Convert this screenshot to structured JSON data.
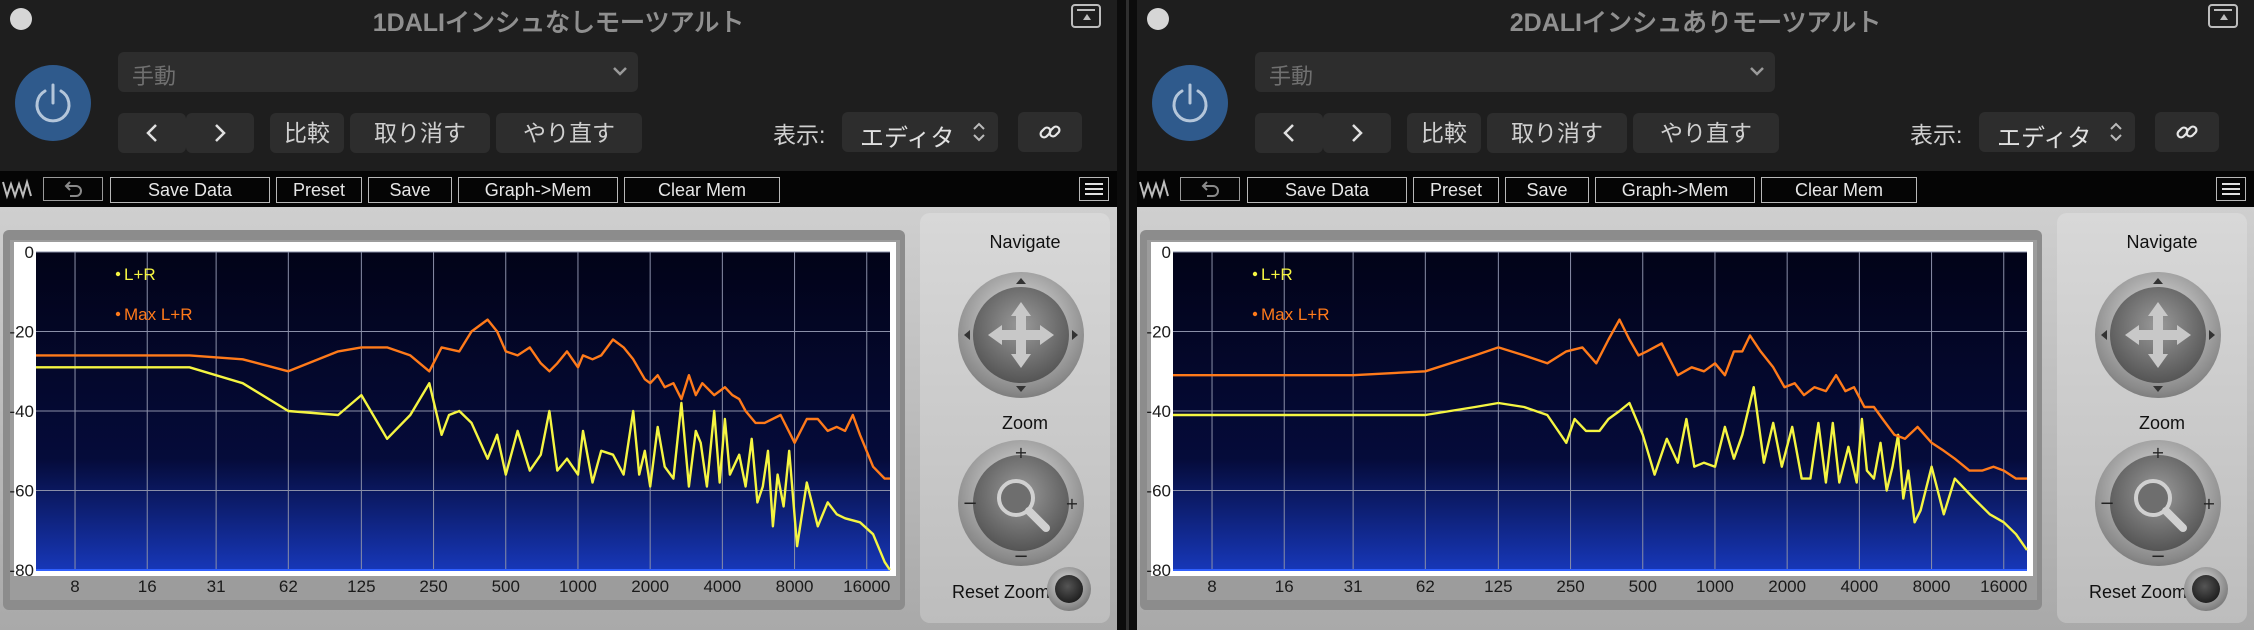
{
  "windows": [
    {
      "title": "1DALIインシュなしモーツアルト",
      "preset_value": "手動",
      "compare_label": "比較",
      "undo_label": "取り消す",
      "redo_label": "やり直す",
      "display_label": "表示:",
      "display_value": "エディタ",
      "toolbar": {
        "save_data": "Save Data",
        "preset": "Preset",
        "save": "Save",
        "graph_mem": "Graph->Mem",
        "clear_mem": "Clear Mem"
      },
      "navigate_label": "Navigate",
      "zoom_label": "Zoom",
      "reset_zoom_label": "Reset Zoom",
      "chart_data": {
        "type": "line",
        "x_scale": "log",
        "x_ticks": [
          8,
          16,
          31,
          62,
          125,
          250,
          500,
          1000,
          2000,
          4000,
          8000,
          16000
        ],
        "x_tick_labels": [
          "8",
          "16",
          "31",
          "62",
          "125",
          "250",
          "500",
          "1000",
          "2000",
          "4000",
          "8000",
          "16000"
        ],
        "y_ticks": [
          0,
          -20,
          -40,
          -60,
          -80
        ],
        "y_tick_labels": [
          "0",
          "-20",
          "-40",
          "-60",
          "-80"
        ],
        "ylim": [
          -80,
          0
        ],
        "xlim": [
          5.5,
          20000
        ],
        "grid": true,
        "legend": "top-left",
        "series": [
          {
            "name": "L+R",
            "color": "#f5f542",
            "x": [
              5.5,
              8,
              16,
              24,
              40,
              62,
              100,
              125,
              160,
              200,
              240,
              270,
              290,
              320,
              360,
              420,
              460,
              500,
              560,
              630,
              700,
              760,
              820,
              900,
              1000,
              1050,
              1150,
              1250,
              1400,
              1550,
              1700,
              1800,
              1900,
              2000,
              2150,
              2300,
              2500,
              2700,
              2900,
              3100,
              3250,
              3450,
              3700,
              3900,
              4100,
              4300,
              4700,
              5000,
              5300,
              5600,
              5900,
              6200,
              6500,
              6800,
              7200,
              7600,
              8200,
              9000,
              10000,
              11000,
              12000,
              13000,
              15000,
              17000,
              19000,
              20000
            ],
            "y": [
              -29,
              -29,
              -29,
              -29,
              -33,
              -40,
              -41,
              -36,
              -47,
              -41,
              -33,
              -46,
              -41,
              -40,
              -43,
              -52,
              -46,
              -56,
              -45,
              -55,
              -51,
              -40,
              -55,
              -52,
              -56,
              -45,
              -58,
              -50,
              -51,
              -56,
              -40,
              -56,
              -50,
              -59,
              -44,
              -54,
              -57,
              -38,
              -59,
              -45,
              -48,
              -59,
              -40,
              -58,
              -42,
              -56,
              -51,
              -59,
              -47,
              -63,
              -59,
              -50,
              -69,
              -56,
              -64,
              -50,
              -74,
              -58,
              -69,
              -63,
              -66,
              -67,
              -68,
              -71,
              -78,
              -80
            ]
          },
          {
            "name": "Max L+R",
            "color": "#ff7a1a",
            "x": [
              5.5,
              8,
              16,
              24,
              40,
              62,
              100,
              125,
              160,
              200,
              240,
              270,
              320,
              360,
              420,
              460,
              500,
              560,
              630,
              700,
              760,
              820,
              900,
              1000,
              1050,
              1150,
              1250,
              1400,
              1550,
              1700,
              1900,
              2000,
              2150,
              2300,
              2500,
              2700,
              2900,
              3100,
              3300,
              3700,
              4100,
              4400,
              4700,
              5000,
              5500,
              6000,
              7000,
              8000,
              9000,
              10000,
              11000,
              12000,
              13000,
              14000,
              15000,
              17000,
              19000,
              20000
            ],
            "y": [
              -26,
              -26,
              -26,
              -26,
              -27,
              -30,
              -25,
              -24,
              -24,
              -26,
              -30,
              -24,
              -25,
              -20,
              -17,
              -20,
              -25,
              -26,
              -24,
              -28,
              -30,
              -28,
              -25,
              -29,
              -26,
              -27,
              -26,
              -22,
              -24,
              -27,
              -32,
              -33,
              -31,
              -34,
              -33,
              -37,
              -31,
              -36,
              -33,
              -36,
              -34,
              -36,
              -37,
              -40,
              -43,
              -43,
              -41,
              -48,
              -42,
              -42,
              -45,
              -44,
              -45,
              -41,
              -46,
              -54,
              -57,
              -57
            ]
          }
        ]
      }
    },
    {
      "title": "2DALIインシュありモーツアルト",
      "preset_value": "手動",
      "compare_label": "比較",
      "undo_label": "取り消す",
      "redo_label": "やり直す",
      "display_label": "表示:",
      "display_value": "エディタ",
      "toolbar": {
        "save_data": "Save Data",
        "preset": "Preset",
        "save": "Save",
        "graph_mem": "Graph->Mem",
        "clear_mem": "Clear Mem"
      },
      "navigate_label": "Navigate",
      "zoom_label": "Zoom",
      "reset_zoom_label": "Reset Zoom",
      "chart_data": {
        "type": "line",
        "x_scale": "log",
        "x_ticks": [
          8,
          16,
          31,
          62,
          125,
          250,
          500,
          1000,
          2000,
          4000,
          8000,
          16000
        ],
        "x_tick_labels": [
          "8",
          "16",
          "31",
          "62",
          "125",
          "250",
          "500",
          "1000",
          "2000",
          "4000",
          "8000",
          "16000"
        ],
        "y_ticks": [
          0,
          -20,
          -40,
          -60,
          -80
        ],
        "y_tick_labels": [
          "0",
          "-20",
          "-40",
          "-60",
          "-80"
        ],
        "ylim": [
          -80,
          0
        ],
        "xlim": [
          5.5,
          20000
        ],
        "grid": true,
        "legend": "top-left",
        "series": [
          {
            "name": "L+R",
            "color": "#f5f542",
            "x": [
              5.5,
              8,
              16,
              31,
              62,
              100,
              125,
              160,
              200,
              240,
              260,
              290,
              330,
              360,
              400,
              440,
              500,
              560,
              630,
              700,
              760,
              820,
              900,
              1000,
              1100,
              1200,
              1300,
              1450,
              1600,
              1750,
              1900,
              2100,
              2300,
              2500,
              2700,
              2900,
              3100,
              3300,
              3600,
              3900,
              4100,
              4300,
              4600,
              4900,
              5200,
              5500,
              5800,
              6100,
              6400,
              6800,
              7200,
              8000,
              9000,
              10000,
              12000,
              14000,
              16000,
              18000,
              20000
            ],
            "y": [
              -41,
              -41,
              -41,
              -41,
              -41,
              -39,
              -38,
              -39,
              -41,
              -48,
              -42,
              -45,
              -45,
              -42,
              -40,
              -38,
              -46,
              -56,
              -47,
              -53,
              -42,
              -54,
              -53,
              -54,
              -44,
              -52,
              -46,
              -34,
              -53,
              -43,
              -54,
              -44,
              -57,
              -57,
              -43,
              -58,
              -43,
              -58,
              -49,
              -58,
              -42,
              -55,
              -57,
              -48,
              -60,
              -54,
              -46,
              -62,
              -55,
              -68,
              -65,
              -54,
              -66,
              -57,
              -62,
              -66,
              -68,
              -71,
              -75
            ]
          },
          {
            "name": "Max L+R",
            "color": "#ff7a1a",
            "x": [
              5.5,
              8,
              16,
              31,
              62,
              100,
              125,
              160,
              200,
              240,
              280,
              320,
              360,
              400,
              440,
              480,
              520,
              600,
              700,
              800,
              900,
              1000,
              1100,
              1200,
              1300,
              1400,
              1550,
              1750,
              1950,
              2150,
              2350,
              2600,
              2900,
              3200,
              3500,
              3800,
              4200,
              4600,
              5000,
              5600,
              6200,
              7000,
              8000,
              9000,
              10000,
              11500,
              13000,
              14500,
              16000,
              18000,
              20000
            ],
            "y": [
              -31,
              -31,
              -31,
              -31,
              -30,
              -26,
              -24,
              -26,
              -28,
              -25,
              -24,
              -28,
              -22,
              -17,
              -22,
              -26,
              -25,
              -23,
              -31,
              -29,
              -30,
              -28,
              -31,
              -25,
              -25,
              -21,
              -25,
              -29,
              -34,
              -33,
              -36,
              -34,
              -35,
              -31,
              -35,
              -34,
              -39,
              -39,
              -42,
              -46,
              -47,
              -44,
              -48,
              -50,
              -52,
              -55,
              -55,
              -54,
              -55,
              -57,
              -57
            ]
          }
        ]
      }
    }
  ]
}
